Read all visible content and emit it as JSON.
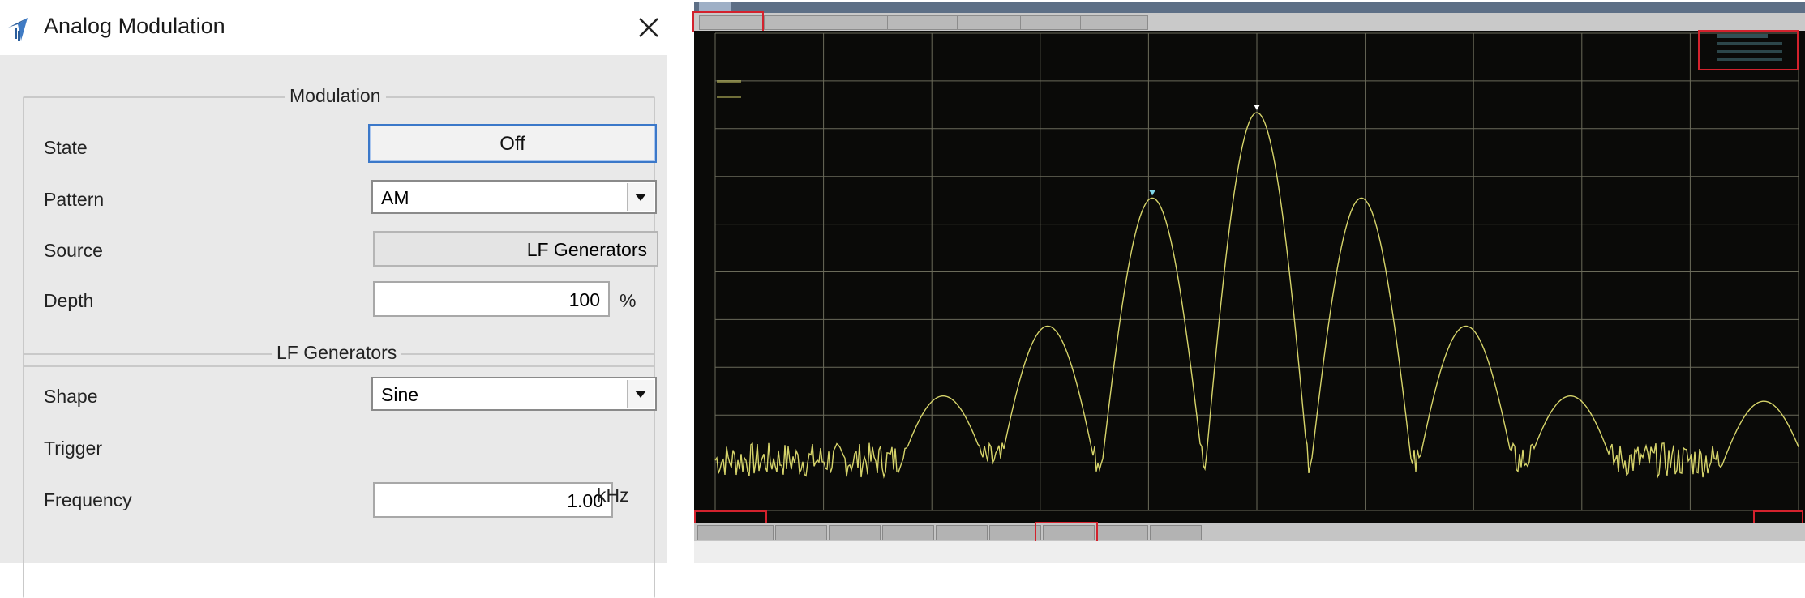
{
  "dialog": {
    "title": "Analog Modulation",
    "modulation": {
      "legend": "Modulation",
      "state_label": "State",
      "state_value": "Off",
      "pattern_label": "Pattern",
      "pattern_value": "AM",
      "source_label": "Source",
      "source_value": "LF Generators",
      "depth_label": "Depth",
      "depth_value": "100",
      "depth_unit": "%"
    },
    "lf": {
      "legend": "LF Generators",
      "shape_label": "Shape",
      "shape_value": "Sine",
      "trigger_label": "Trigger",
      "frequency_label": "Frequency",
      "frequency_value": "1.00",
      "frequency_unit": "kHz"
    }
  },
  "analyzer": {
    "colors": {
      "trace": "#d6d46a",
      "grid": "#6b6b5a",
      "highlight": "#d3222d",
      "marker": "#7fd4e6"
    },
    "spectrum": {
      "center_peak_level": 1.0,
      "first_sideband_level": 0.78,
      "second_sideband_level": 0.45,
      "third_sideband_level": 0.27
    }
  }
}
